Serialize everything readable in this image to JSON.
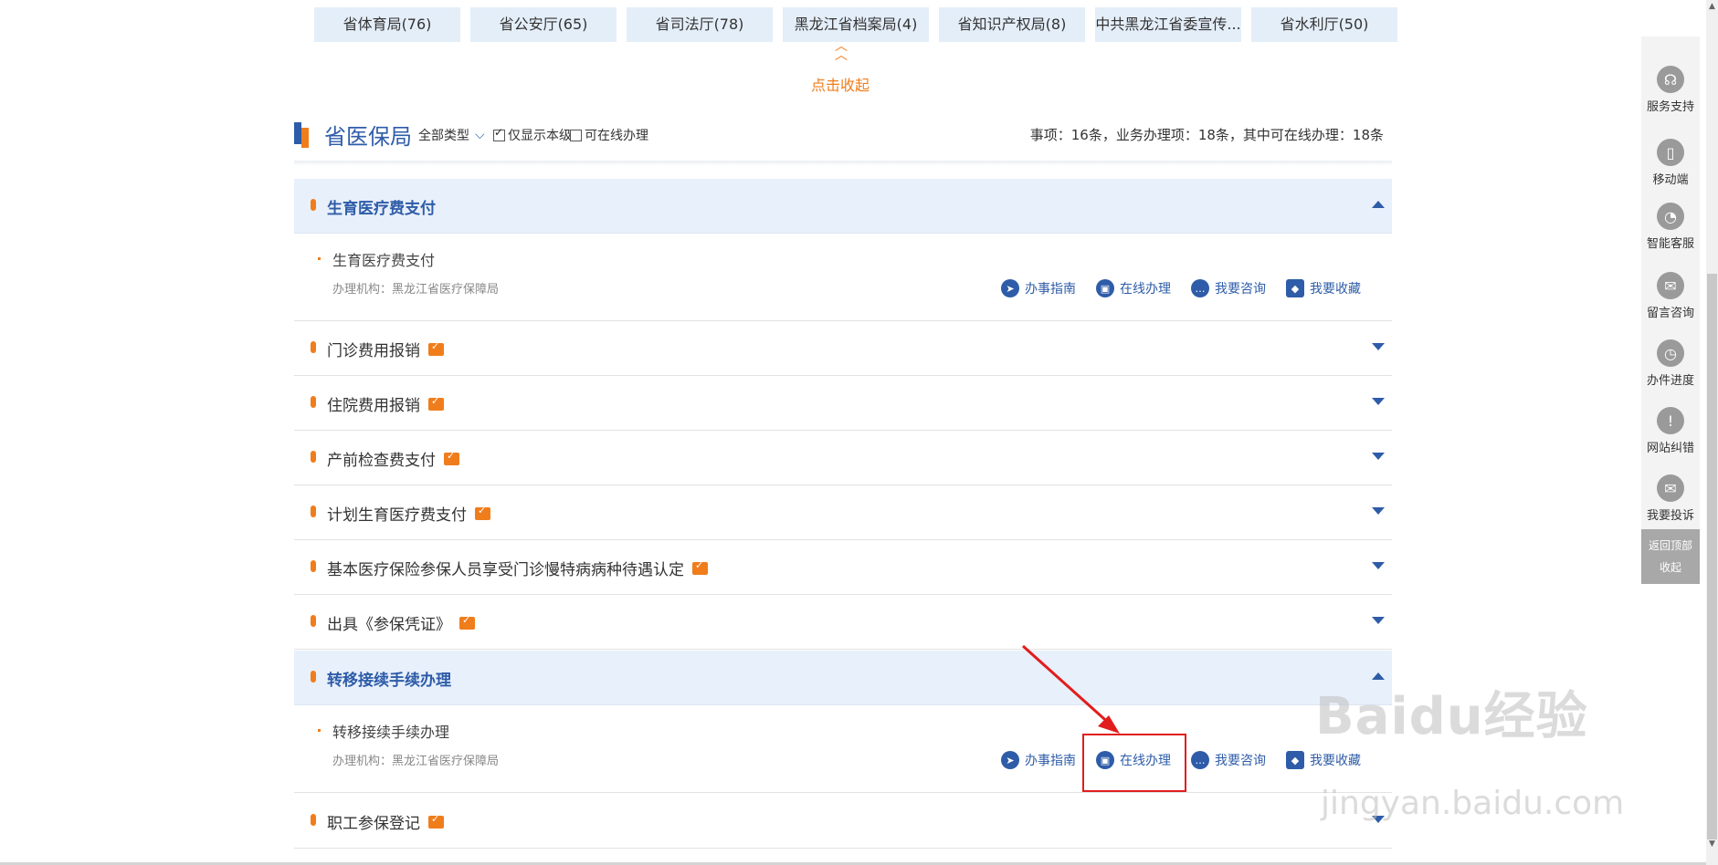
{
  "dept_tabs": [
    "省体育局(76)",
    "省公安厅(65)",
    "省司法厅(78)",
    "黑龙江省档案局(4)",
    "省知识产权局(8)",
    "中共黑龙江省委宣传...",
    "省水利厅(50)"
  ],
  "collapse_label": "点击收起",
  "header": {
    "title": "省医保局",
    "type_filter": "全部类型",
    "only_this_level": "仅显示本级",
    "online_only": "可在线办理",
    "stats": "事项：16条，业务办理项：18条，其中可在线办理：18条"
  },
  "items": [
    {
      "label": "生育医疗费支付",
      "open": true
    },
    {
      "label": "门诊费用报销",
      "open": false
    },
    {
      "label": "住院费用报销",
      "open": false
    },
    {
      "label": "产前检查费支付",
      "open": false
    },
    {
      "label": "计划生育医疗费支付",
      "open": false
    },
    {
      "label": "基本医疗保险参保人员享受门诊慢特病病种待遇认定",
      "open": false
    },
    {
      "label": "出具《参保凭证》",
      "open": false
    },
    {
      "label": "转移接续手续办理",
      "open": true
    },
    {
      "label": "职工参保登记",
      "open": false
    }
  ],
  "details": [
    {
      "title": "生育医疗费支付",
      "org": "办理机构：黑龙江省医疗保障局"
    },
    {
      "title": "转移接续手续办理",
      "org": "办理机构：黑龙江省医疗保障局"
    }
  ],
  "actions": {
    "guide": "办事指南",
    "online": "在线办理",
    "consult": "我要咨询",
    "favorite": "我要收藏"
  },
  "sidebar": {
    "items": [
      "服务支持",
      "移动端",
      "智能客服",
      "留言咨询",
      "办件进度",
      "网站纠错",
      "我要投诉"
    ],
    "back_top": "返回顶部",
    "collapse": "收起"
  },
  "watermark": {
    "brand": "Baidu经验",
    "url": "jingyan.baidu.com"
  },
  "colors": {
    "brand_blue": "#2e5ca8",
    "accent_orange": "#f07d1c",
    "tab_bg": "#e4eef9",
    "annotation_red": "#e21d1d"
  }
}
